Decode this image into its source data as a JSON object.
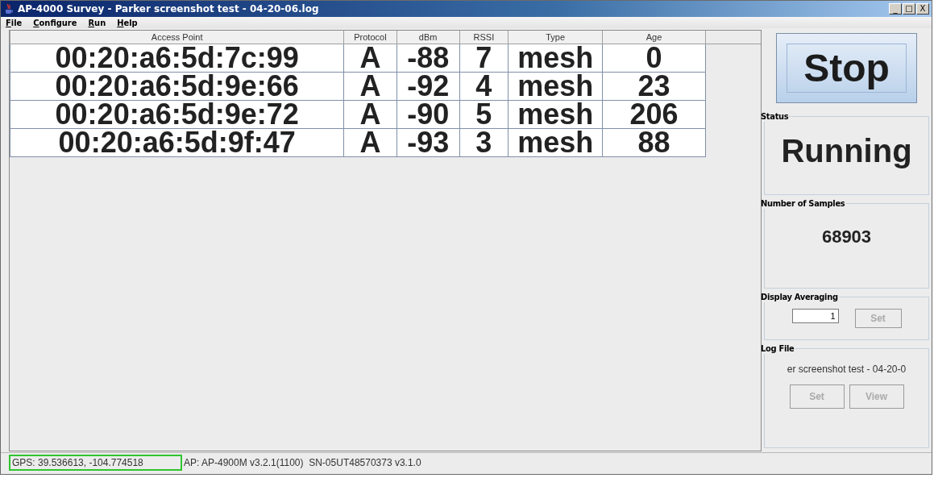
{
  "window": {
    "title": "AP-4000 Survey - Parker screenshot test - 04-20-06.log",
    "controls": [
      "_",
      "□",
      "X"
    ]
  },
  "menu": [
    {
      "label": "File",
      "mnemonic": true
    },
    {
      "label": "Configure",
      "mnemonic": true
    },
    {
      "label": "Run",
      "mnemonic": true
    },
    {
      "label": "Help",
      "mnemonic": true
    }
  ],
  "table": {
    "columns": [
      "Access Point",
      "Protocol",
      "dBm",
      "RSSI",
      "Type",
      "Age"
    ],
    "rows": [
      [
        "00:20:a6:5d:7c:99",
        "A",
        "-88",
        "7",
        "mesh",
        "0"
      ],
      [
        "00:20:a6:5d:9e:66",
        "A",
        "-92",
        "4",
        "mesh",
        "23"
      ],
      [
        "00:20:a6:5d:9e:72",
        "A",
        "-90",
        "5",
        "mesh",
        "206"
      ],
      [
        "00:20:a6:5d:9f:47",
        "A",
        "-93",
        "3",
        "mesh",
        "88"
      ]
    ]
  },
  "stop_button": {
    "label": "Stop",
    "disabled": false
  },
  "status": {
    "title": "Status",
    "value": "Running"
  },
  "samples": {
    "title": "Number of Samples",
    "value": "68903"
  },
  "display_averaging": {
    "title": "Display Averaging",
    "value": "1",
    "button": {
      "label": "Set",
      "disabled": true
    }
  },
  "log_file": {
    "title": "Log File",
    "value": "er screenshot test - 04-20-0",
    "buttons": [
      {
        "label": "Set",
        "disabled": true
      },
      {
        "label": "View",
        "disabled": true
      }
    ]
  },
  "status_bar": {
    "gps": {
      "text": "GPS: 39.536613, -104.774518",
      "highlighted": true
    },
    "ap": "AP: AP-4900M v3.2.1(1100)  SN-05UT48570373 v3.1.0"
  }
}
